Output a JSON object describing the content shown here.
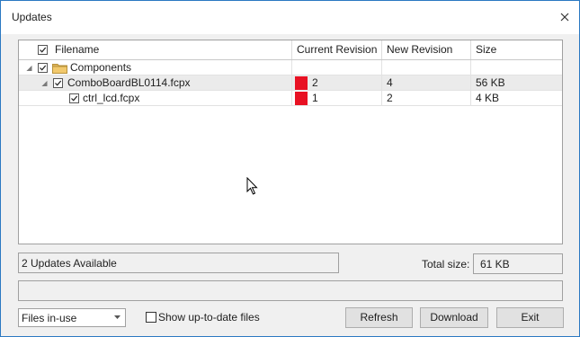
{
  "window": {
    "title": "Updates"
  },
  "tree": {
    "columns": [
      "Filename",
      "Current Revision",
      "New Revision",
      "Size"
    ],
    "rows": [
      {
        "name": "Components",
        "current": "",
        "new": "",
        "size": ""
      },
      {
        "name": "ComboBoardBL0114.fcpx",
        "current": "2",
        "new": "4",
        "size": "56 KB"
      },
      {
        "name": "ctrl_lcd.fcpx",
        "current": "1",
        "new": "2",
        "size": "4 KB"
      }
    ]
  },
  "status": {
    "updates_available": "2 Updates Available",
    "total_size_label": "Total size:",
    "total_size_value": "61 KB"
  },
  "filter": {
    "selected": "Files in-use",
    "show_uptodate_label": "Show up-to-date files"
  },
  "buttons": {
    "refresh": "Refresh",
    "download": "Download",
    "exit": "Exit"
  },
  "colors": {
    "stale_revision": "#e81123",
    "accent": "#2b79c2"
  }
}
